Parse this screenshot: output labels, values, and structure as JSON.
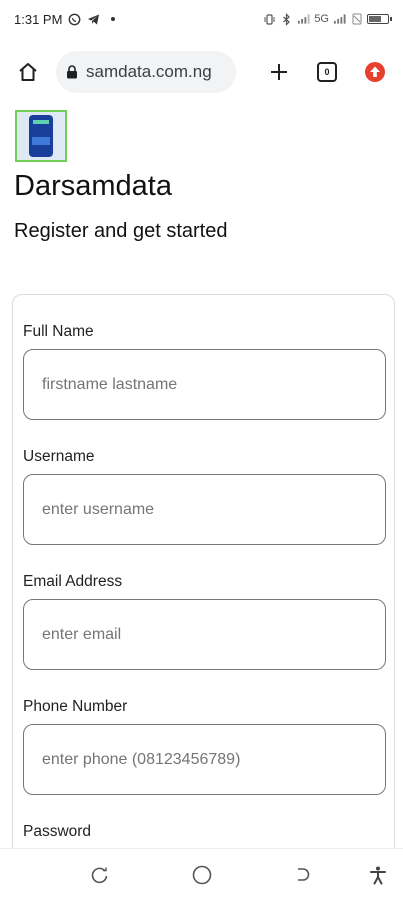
{
  "status_bar": {
    "time": "1:31 PM",
    "network_text": "5G"
  },
  "browser": {
    "url": "samdata.com.ng",
    "tab_count": "0"
  },
  "page": {
    "site_title": "Darsamdata",
    "subtitle": "Register and get started"
  },
  "form": {
    "fields": [
      {
        "label": "Full Name",
        "placeholder": "firstname lastname"
      },
      {
        "label": "Username",
        "placeholder": "enter username"
      },
      {
        "label": "Email Address",
        "placeholder": "enter email"
      },
      {
        "label": "Phone Number",
        "placeholder": "enter phone (08123456789)"
      },
      {
        "label": "Password"
      }
    ]
  },
  "colors": {
    "accent_red": "#e8402f",
    "logo_border": "#6fcf56"
  }
}
